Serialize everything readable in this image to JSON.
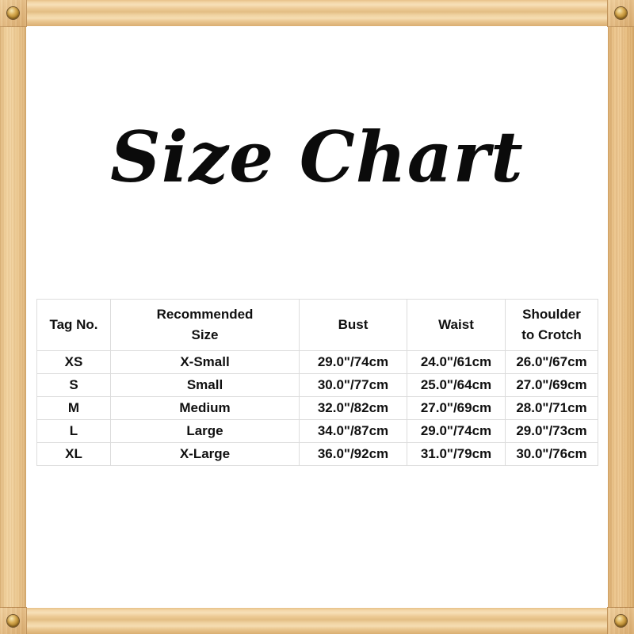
{
  "title": "Size Chart",
  "frame": {
    "material": "wood",
    "wood_color": "#E8C68E",
    "screw_color": "#C79A3A",
    "screws": [
      {
        "name": "screw-top-left"
      },
      {
        "name": "screw-top-right"
      },
      {
        "name": "screw-bottom-left"
      },
      {
        "name": "screw-bottom-right"
      }
    ]
  },
  "table": {
    "headers": [
      {
        "line1": "Tag No.",
        "line2": ""
      },
      {
        "line1": "Recommended",
        "line2": "Size"
      },
      {
        "line1": "Bust",
        "line2": ""
      },
      {
        "line1": "Waist",
        "line2": ""
      },
      {
        "line1": "Shoulder",
        "line2": "to Crotch"
      }
    ],
    "rows": [
      {
        "tag": "XS",
        "recommended_size": "X-Small",
        "bust": "29.0\"/74cm",
        "waist": "24.0\"/61cm",
        "shoulder_to_crotch": "26.0\"/67cm"
      },
      {
        "tag": "S",
        "recommended_size": "Small",
        "bust": "30.0\"/77cm",
        "waist": "25.0\"/64cm",
        "shoulder_to_crotch": "27.0\"/69cm"
      },
      {
        "tag": "M",
        "recommended_size": "Medium",
        "bust": "32.0\"/82cm",
        "waist": "27.0\"/69cm",
        "shoulder_to_crotch": "28.0\"/71cm"
      },
      {
        "tag": "L",
        "recommended_size": "Large",
        "bust": "34.0\"/87cm",
        "waist": "29.0\"/74cm",
        "shoulder_to_crotch": "29.0\"/73cm"
      },
      {
        "tag": "XL",
        "recommended_size": "X-Large",
        "bust": "36.0\"/92cm",
        "waist": "31.0\"/79cm",
        "shoulder_to_crotch": "30.0\"/76cm"
      }
    ]
  }
}
